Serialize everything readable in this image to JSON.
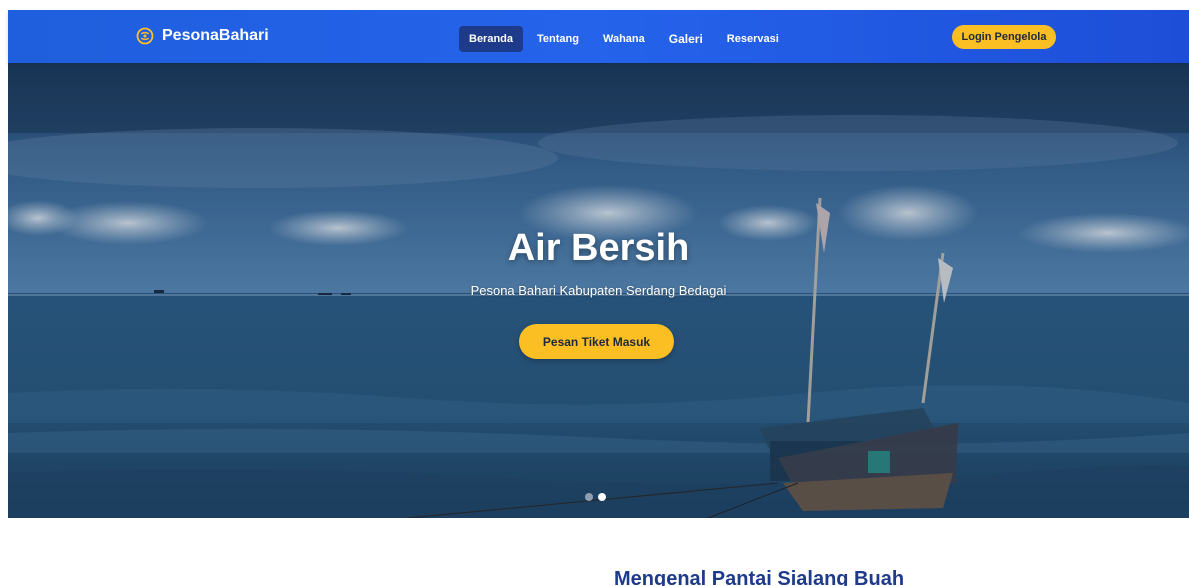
{
  "navbar": {
    "brand": "PesonaBahari",
    "brand_icon": "compass-icon",
    "links": [
      {
        "label": "Beranda",
        "active": true
      },
      {
        "label": "Tentang",
        "active": false
      },
      {
        "label": "Wahana",
        "active": false
      },
      {
        "label": "Galeri",
        "active": false
      },
      {
        "label": "Reservasi",
        "active": false
      }
    ],
    "login_label": "Login Pengelola"
  },
  "hero": {
    "title": "Air Bersih",
    "subtitle": "Pesona Bahari Kabupaten Serdang Bedagai",
    "cta_label": "Pesan Tiket Masuk",
    "slides_total": 2,
    "active_slide": 2
  },
  "about": {
    "title": "Mengenal Pantai Sialang Buah"
  },
  "colors": {
    "nav_blue": "#2563eb",
    "active_link": "#1e3a8a",
    "accent_yellow": "#fbbf24",
    "heading_navy": "#1e3a8a"
  }
}
